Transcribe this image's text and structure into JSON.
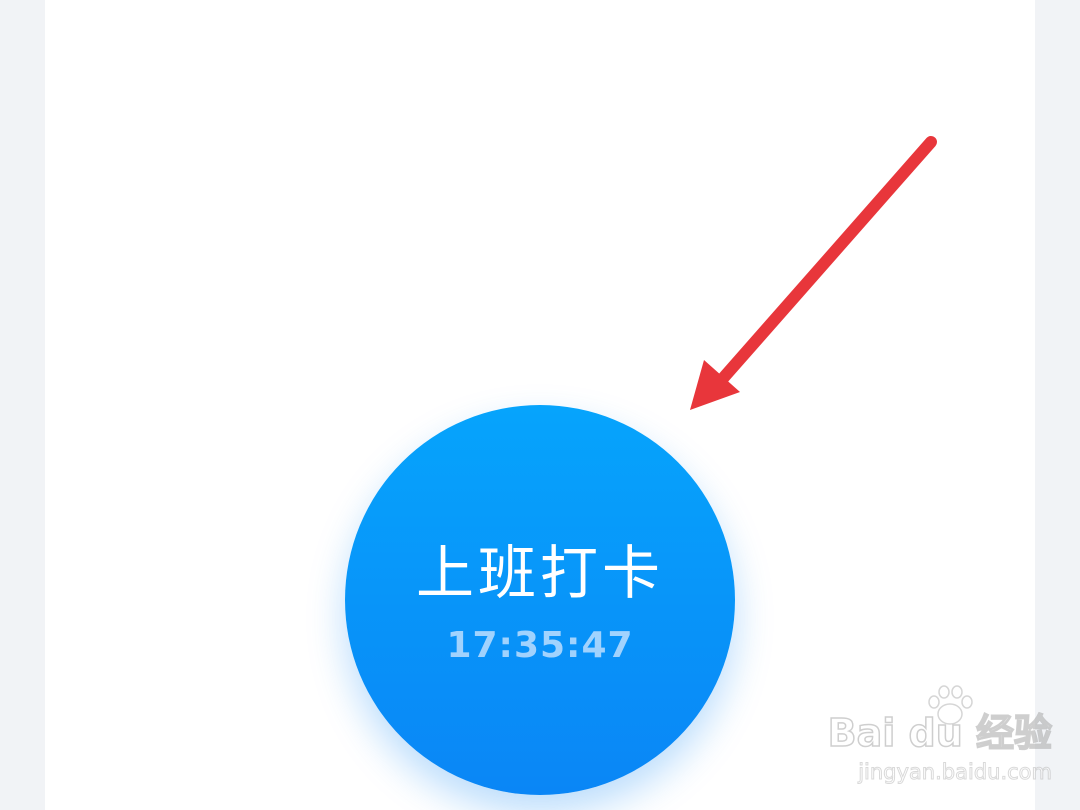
{
  "punch": {
    "label": "上班打卡",
    "time": "17:35:47"
  },
  "watermark": {
    "brand": "Bai du 经验",
    "site": "jingyan.baidu.com"
  },
  "colors": {
    "button_top": "#06a4fc",
    "button_bottom": "#0a86f6",
    "arrow": "#e8363b",
    "card": "#ffffff",
    "side_margin": "#f1f3f6"
  }
}
